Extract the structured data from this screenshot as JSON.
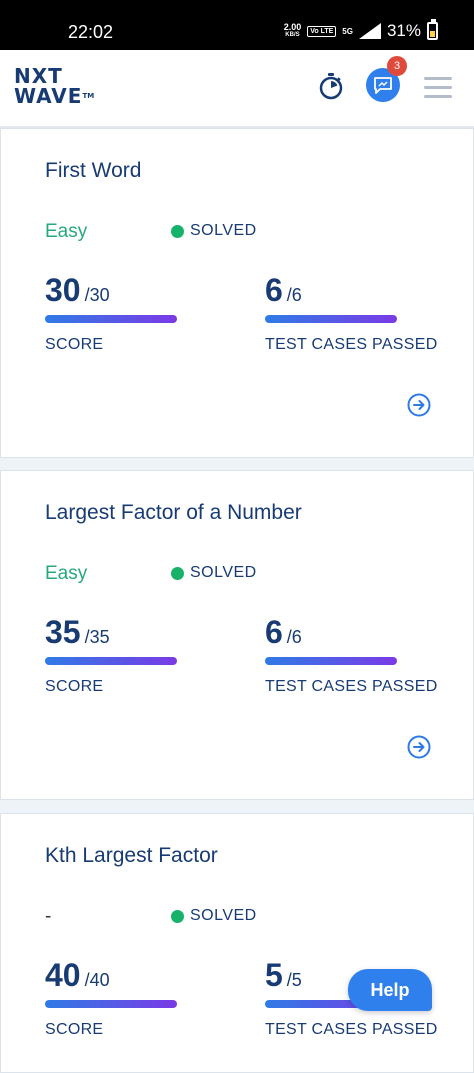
{
  "status_bar": {
    "time": "22:02",
    "net_speed": "2.00",
    "net_unit": "KB/S",
    "volte": "Vo LTE",
    "network": "5G",
    "battery": "31%"
  },
  "header": {
    "logo_line1": "NXT",
    "logo_line2": "WAVE",
    "logo_tm": "TM",
    "notification_count": "3",
    "brand_color": "#183b74",
    "accent_color": "#2f80ed"
  },
  "cards": [
    {
      "title": "First Word",
      "difficulty": "Easy",
      "status": "SOLVED",
      "score": "30",
      "score_total": "/30",
      "score_label": "SCORE",
      "tests": "6",
      "tests_total": "/6",
      "tests_label": "TEST CASES PASSED",
      "score_progress": 1.0,
      "tests_progress": 1.0
    },
    {
      "title": "Largest Factor of a Number",
      "difficulty": "Easy",
      "status": "SOLVED",
      "score": "35",
      "score_total": "/35",
      "score_label": "SCORE",
      "tests": "6",
      "tests_total": "/6",
      "tests_label": "TEST CASES PASSED",
      "score_progress": 1.0,
      "tests_progress": 1.0
    },
    {
      "title": "Kth Largest Factor",
      "difficulty": "-",
      "status": "SOLVED",
      "score": "40",
      "score_total": "/40",
      "score_label": "SCORE",
      "tests": "5",
      "tests_total": "/5",
      "tests_label": "TEST CASES PASSED",
      "score_progress": 1.0,
      "tests_progress": 1.0
    }
  ],
  "help_label": "Help"
}
